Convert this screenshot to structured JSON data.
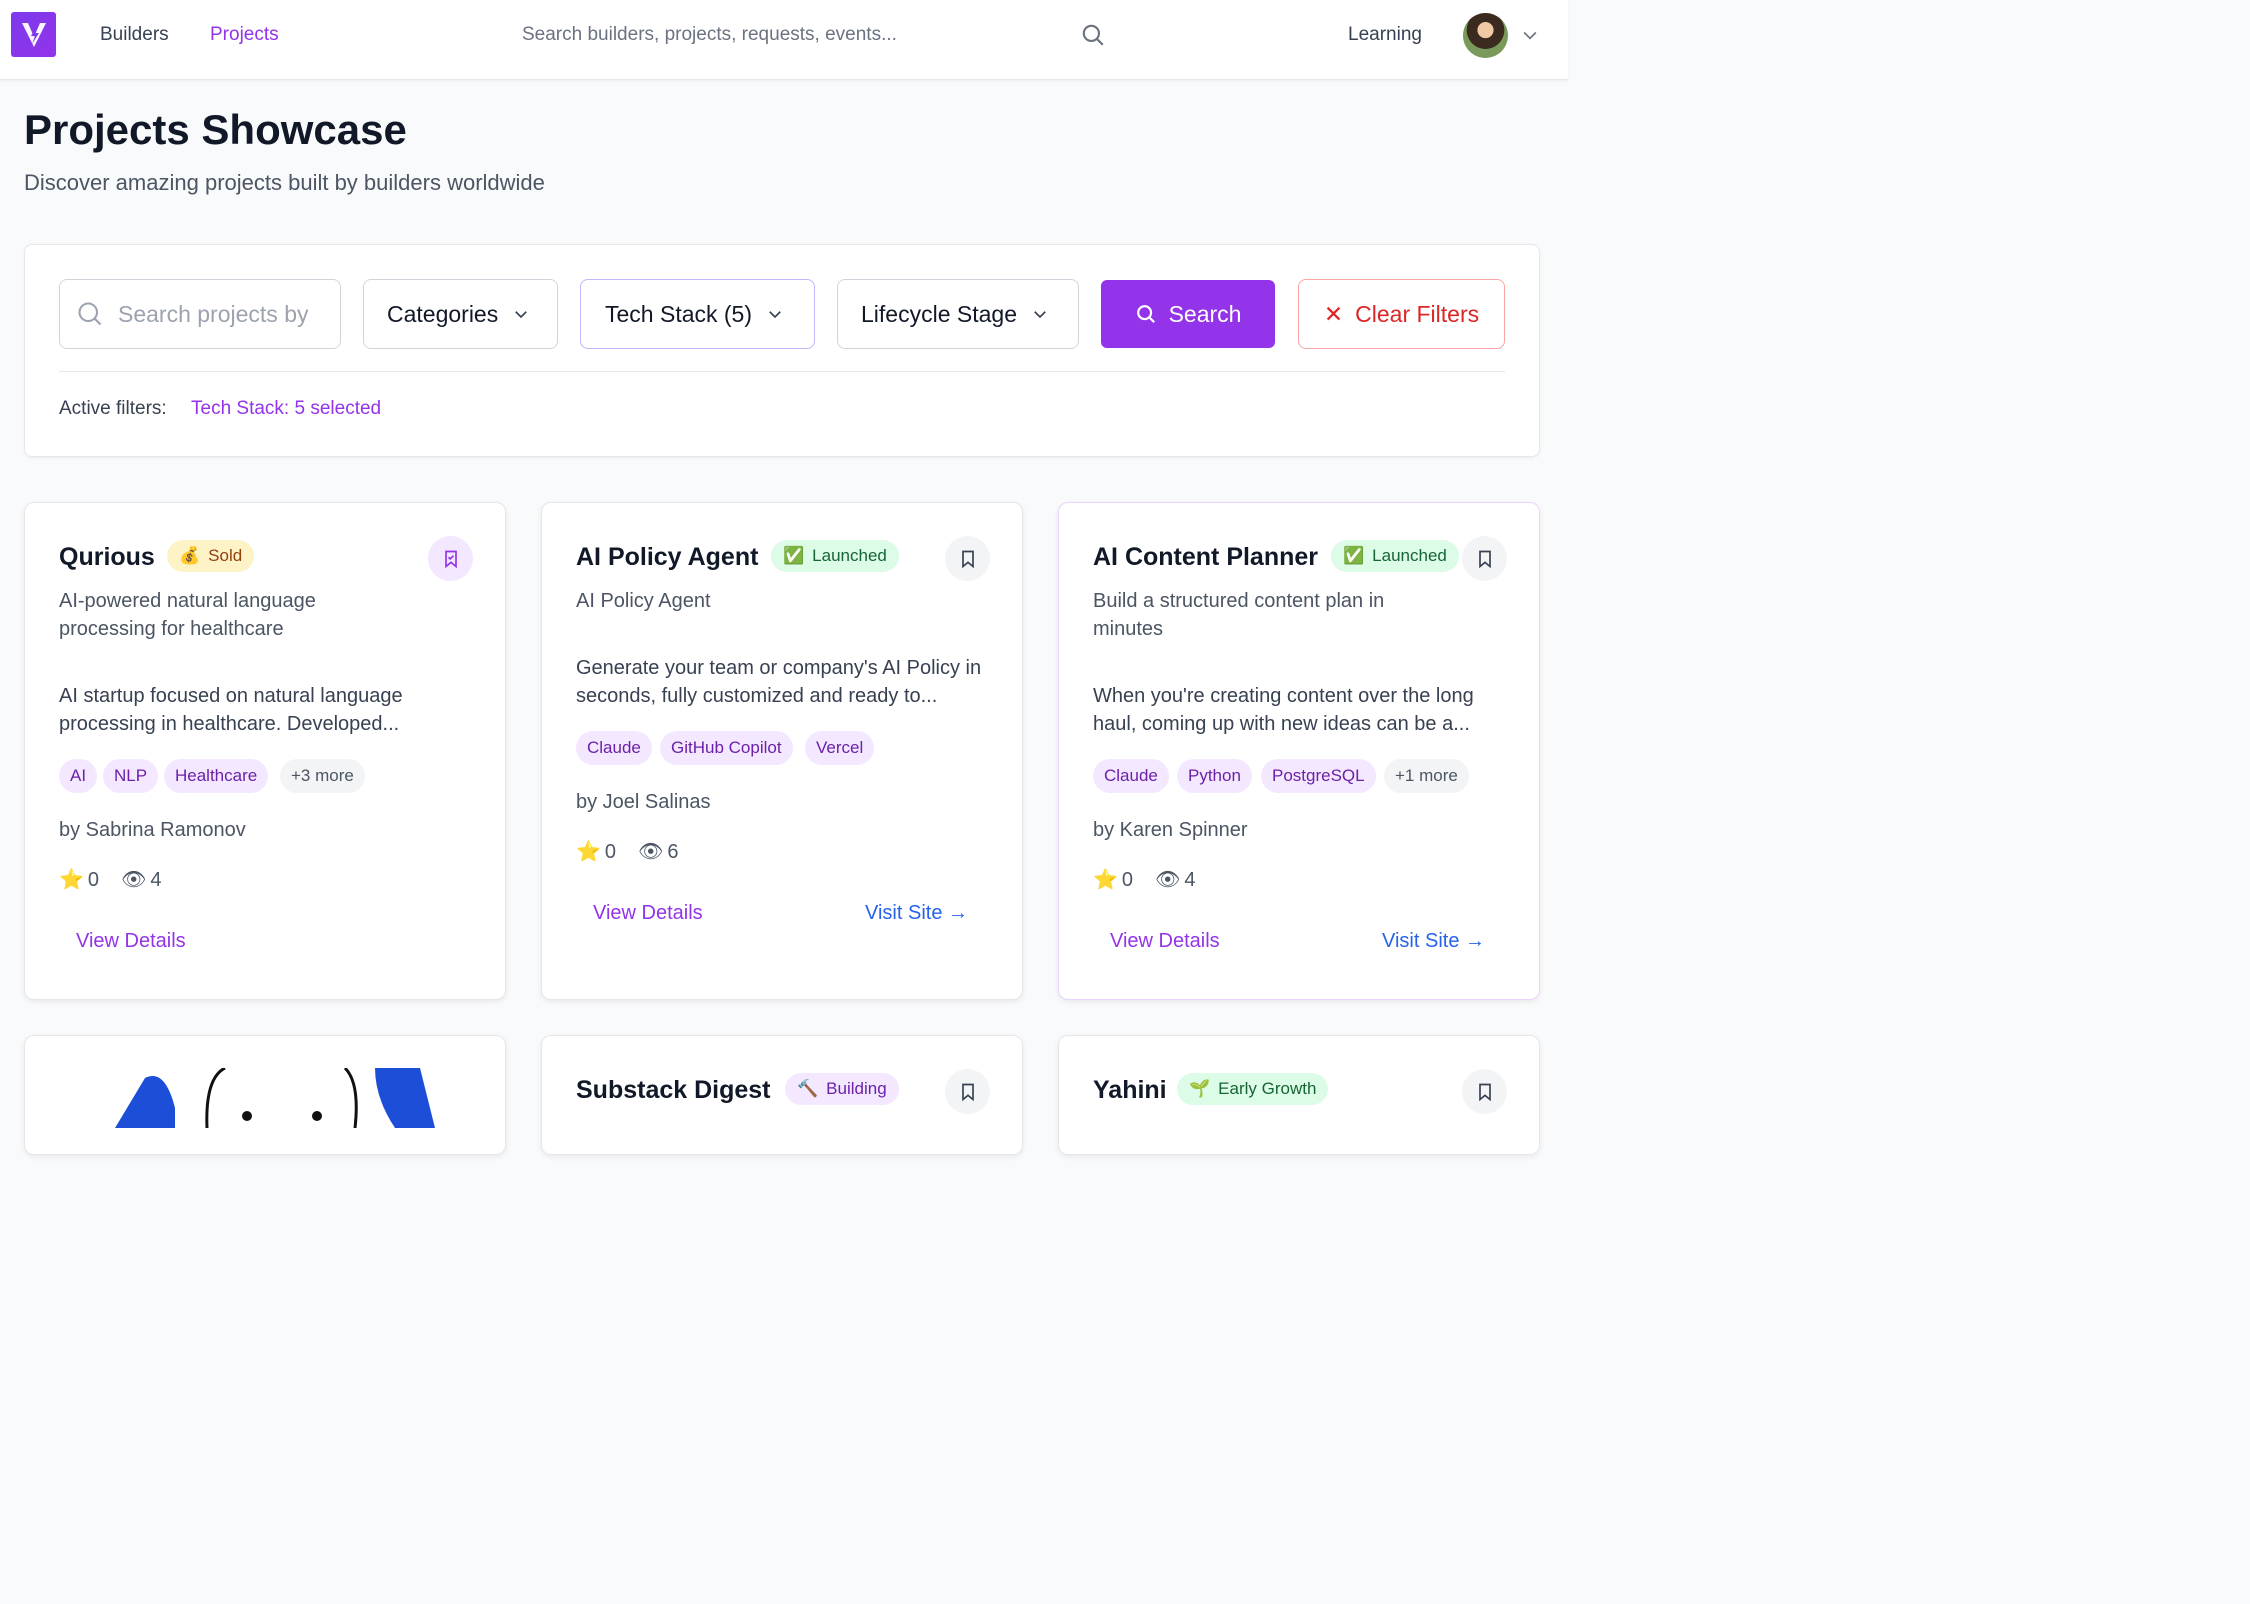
{
  "nav": {
    "builders": "Builders",
    "projects": "Projects",
    "search_placeholder": "Search builders, projects, requests, events...",
    "learning": "Learning"
  },
  "header": {
    "title": "Projects Showcase",
    "subtitle": "Discover amazing projects built by builders worldwide"
  },
  "filters": {
    "search_placeholder": "Search projects by",
    "categories": "Categories",
    "tech_stack": "Tech Stack (5)",
    "lifecycle": "Lifecycle Stage",
    "search_button": "Search",
    "clear_button": "Clear Filters",
    "active_label": "Active filters:",
    "active_value": "Tech Stack: 5 selected"
  },
  "icons": {
    "glyph": "⚡",
    "sold": "💰",
    "launched": "✅",
    "building": "🔨",
    "growth": "🌱",
    "star": "⭐",
    "eye": "👁",
    "close": "✕"
  },
  "colors": {
    "accent": "#9333ea",
    "danger": "#dc2626",
    "link": "#2563eb",
    "launched_bg": "#dcfce7",
    "sold_bg": "#fef3c7"
  },
  "cards": [
    {
      "title": "Qurious",
      "status": "Sold",
      "bookmarked": true,
      "tagline": "AI-powered natural language processing for healthcare",
      "description": "AI startup focused on natural language processing in healthcare. Developed...",
      "tags": [
        "AI",
        "NLP",
        "Healthcare",
        "+3 more"
      ],
      "author": "by Sabrina Ramonov",
      "stars": "0",
      "views": "4",
      "details": "View Details"
    },
    {
      "title": "AI Policy Agent",
      "status": "Launched",
      "bookmarked": false,
      "tagline": "AI Policy Agent",
      "description": "Generate your team or company's AI Policy in seconds, fully customized and ready to...",
      "tags": [
        "Claude",
        "GitHub Copilot",
        "Vercel"
      ],
      "author": "by Joel Salinas",
      "stars": "0",
      "views": "6",
      "details": "View Details",
      "site": "Visit Site →"
    },
    {
      "title": "AI Content Planner",
      "status": "Launched",
      "bookmarked": false,
      "tagline": "Build a structured content plan in minutes",
      "description": "When you're creating content over the long haul, coming up with new ideas can be a...",
      "tags": [
        "Claude",
        "Python",
        "PostgreSQL",
        "+1 more"
      ],
      "author": "by Karen Spinner",
      "stars": "0",
      "views": "4",
      "details": "View Details",
      "site": "Visit Site →"
    },
    {
      "title": "",
      "has_image": true
    },
    {
      "title": "Substack Digest",
      "status": "Building"
    },
    {
      "title": "Yahini",
      "status": "Early Growth"
    }
  ]
}
